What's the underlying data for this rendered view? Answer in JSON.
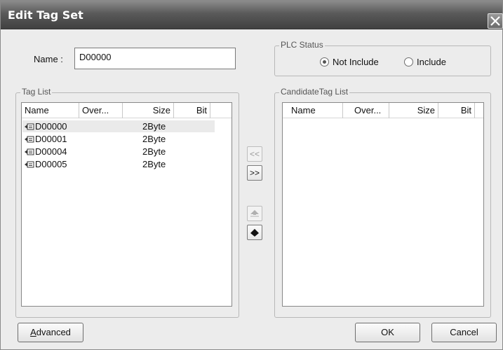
{
  "window": {
    "title": "Edit Tag Set",
    "close_glyph": "✕"
  },
  "name_field": {
    "label": "Name :",
    "value": "D00000"
  },
  "plc_status": {
    "legend": "PLC Status",
    "options": [
      {
        "label": "Not Include",
        "checked": true
      },
      {
        "label": "Include",
        "checked": false
      }
    ]
  },
  "tag_list": {
    "legend": "Tag List",
    "columns": [
      "Name",
      "Over...",
      "Size",
      "Bit"
    ],
    "rows": [
      {
        "name": "D00000",
        "over": "",
        "size": "2Byte",
        "bit": "",
        "selected": true
      },
      {
        "name": "D00001",
        "over": "",
        "size": "2Byte",
        "bit": ""
      },
      {
        "name": "D00004",
        "over": "",
        "size": "2Byte",
        "bit": ""
      },
      {
        "name": "D00005",
        "over": "",
        "size": "2Byte",
        "bit": ""
      }
    ]
  },
  "candidate_list": {
    "legend": "CandidateTag List",
    "columns": [
      "Name",
      "Over...",
      "Size",
      "Bit"
    ],
    "rows": []
  },
  "transfer": {
    "add_label": "<<",
    "remove_label": ">>"
  },
  "icons": {
    "tag": "tag-icon",
    "move_up": "move-up-icon",
    "move_down": "move-down-icon",
    "close": "close-icon"
  },
  "footer": {
    "advanced_label": "Advanced",
    "ok_label": "OK",
    "cancel_label": "Cancel"
  }
}
